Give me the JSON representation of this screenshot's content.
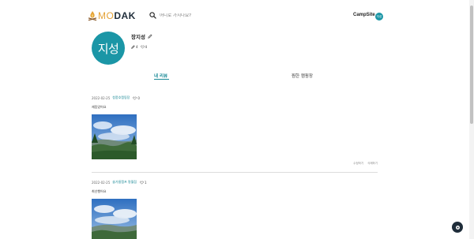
{
  "header": {
    "logo_mo": "MO",
    "logo_dak": "DAK",
    "search_placeholder": "어디로 가시나요?",
    "nav_link": "CampSite",
    "user_avatar": "지성"
  },
  "profile": {
    "avatar_text": "지성",
    "name": "장지성",
    "review_count": "4",
    "like_count": "4"
  },
  "tabs": {
    "my_reviews": "내 리뷰",
    "liked_campsites": "찜한 캠핑장",
    "active": "my_reviews"
  },
  "reviews": [
    {
      "date": "2022-02-25",
      "campsite": "청풍호캠핑장",
      "likes": "0",
      "text": "재밌었어요",
      "edit_label": "수정하기",
      "delete_label": "삭제하기"
    },
    {
      "date": "2022-02-25",
      "campsite": "솔가름캠프 명월점",
      "likes": "1",
      "text": "최선행어요"
    }
  ],
  "colors": {
    "accent": "#1b8a97",
    "avatar_bg": "#1b96a6",
    "logo_orange": "#e5a236",
    "dark": "#1f2d3a"
  },
  "icons": {
    "search": "search-icon",
    "edit": "pencil-icon",
    "heart": "heart-icon",
    "chat": "chat-icon"
  }
}
